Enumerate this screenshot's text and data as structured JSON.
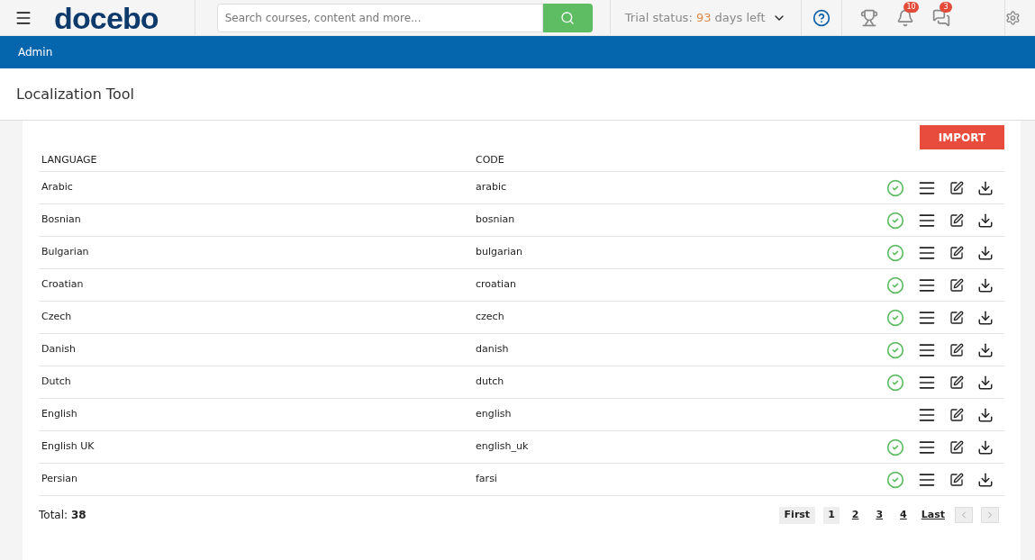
{
  "header": {
    "logo": "docebo",
    "search": {
      "placeholder": "Search courses, content and more..."
    },
    "trial": {
      "label": "Trial status:",
      "days": "93",
      "suffix": "days left"
    },
    "notifications": {
      "count": "10"
    },
    "messages": {
      "count": "3"
    }
  },
  "breadcrumb": "Admin",
  "page_title": "Localization Tool",
  "import_button": "IMPORT",
  "table": {
    "columns": [
      "LANGUAGE",
      "CODE"
    ],
    "rows": [
      {
        "language": "Arabic",
        "code": "arabic",
        "active": true
      },
      {
        "language": "Bosnian",
        "code": "bosnian",
        "active": true
      },
      {
        "language": "Bulgarian",
        "code": "bulgarian",
        "active": true
      },
      {
        "language": "Croatian",
        "code": "croatian",
        "active": true
      },
      {
        "language": "Czech",
        "code": "czech",
        "active": true
      },
      {
        "language": "Danish",
        "code": "danish",
        "active": true
      },
      {
        "language": "Dutch",
        "code": "dutch",
        "active": true
      },
      {
        "language": "English",
        "code": "english",
        "active": false
      },
      {
        "language": "English UK",
        "code": "english_uk",
        "active": true
      },
      {
        "language": "Persian",
        "code": "farsi",
        "active": true
      }
    ]
  },
  "total": {
    "label": "Total:",
    "value": "38"
  },
  "pagination": {
    "first": "First",
    "last": "Last",
    "pages": [
      {
        "label": "1",
        "selected": true
      },
      {
        "label": "2",
        "selected": false
      },
      {
        "label": "3",
        "selected": false
      },
      {
        "label": "4",
        "selected": false
      }
    ]
  }
}
